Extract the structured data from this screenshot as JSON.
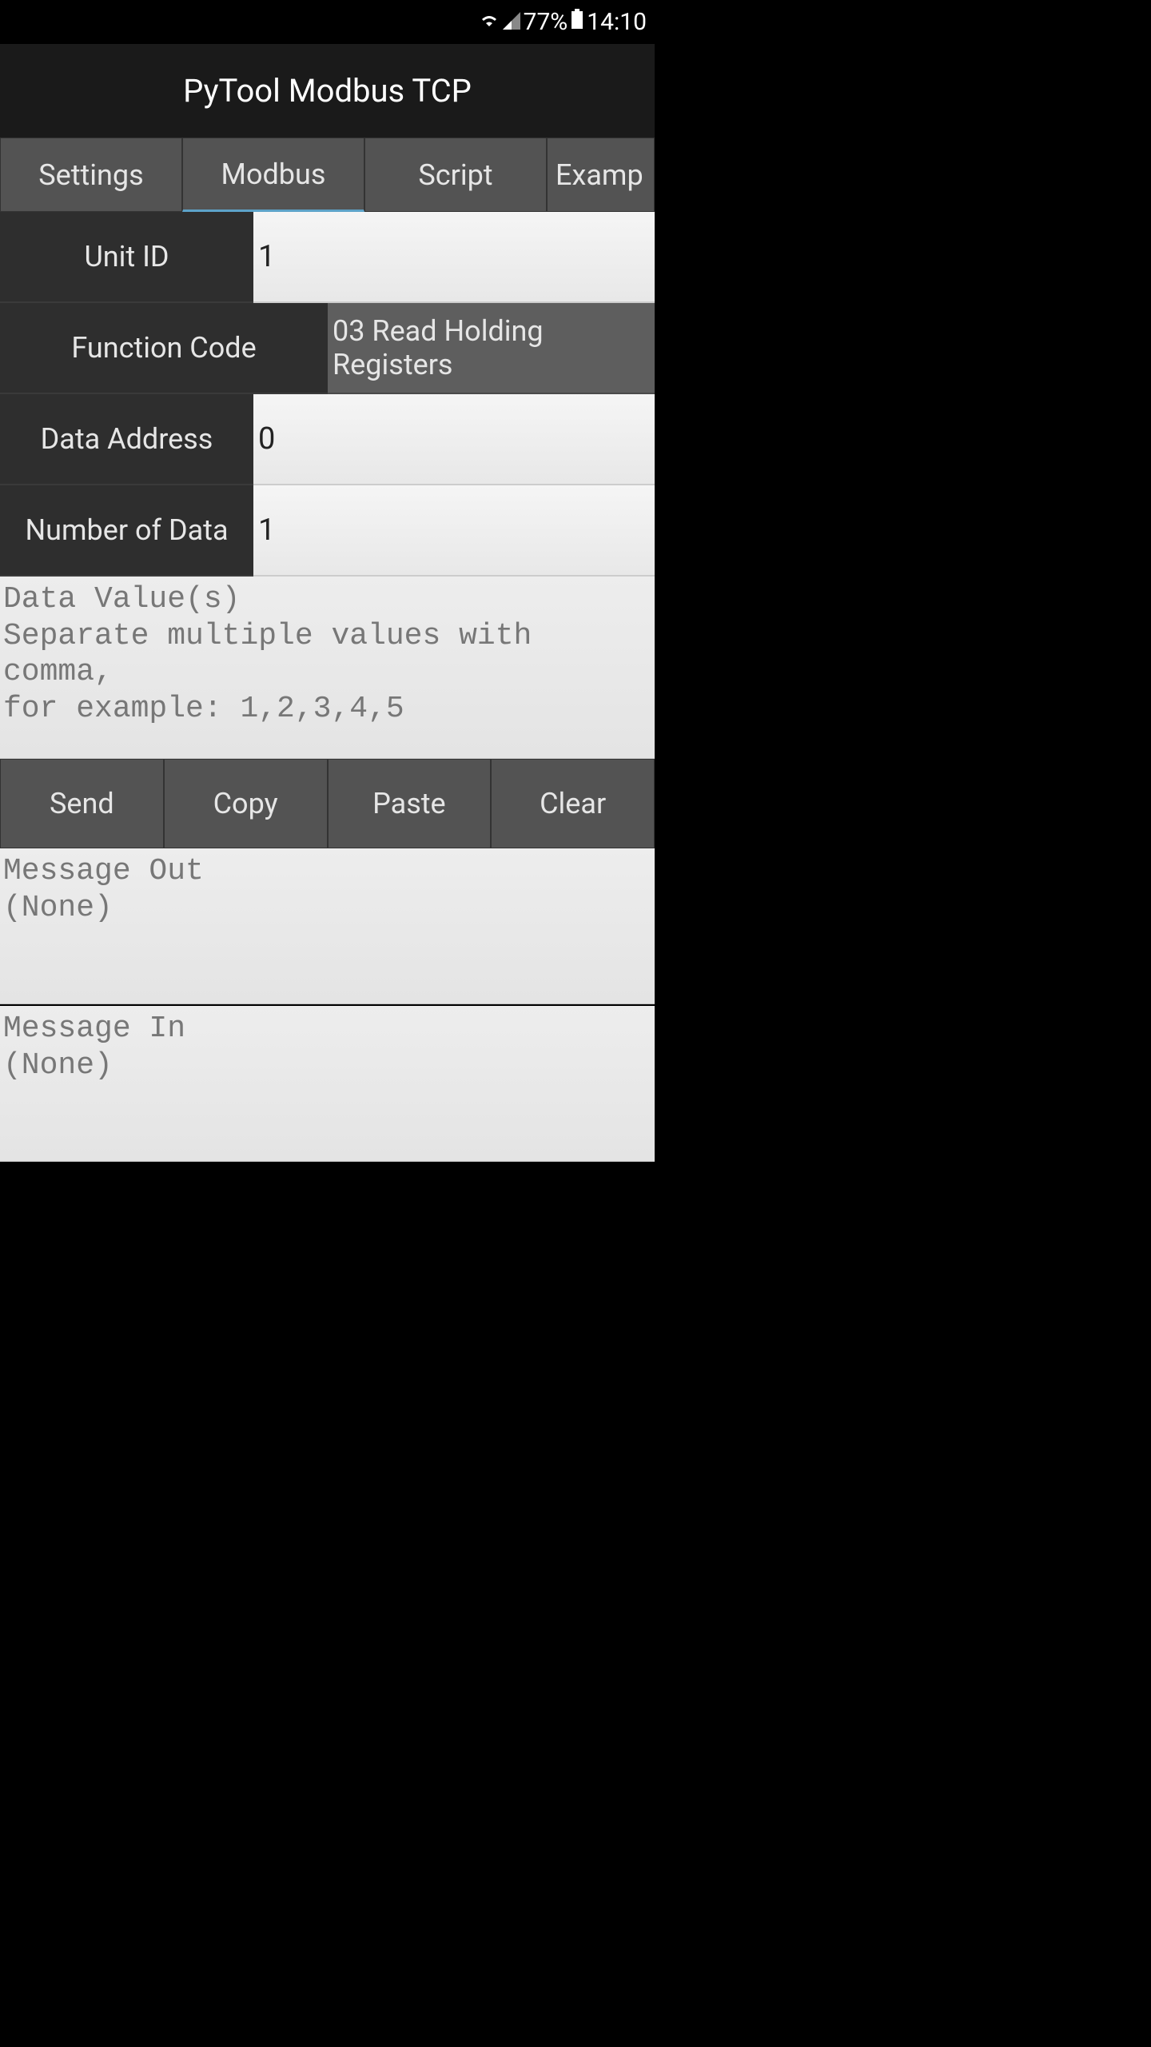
{
  "status_bar": {
    "battery_percent": "77%",
    "time": "14:10"
  },
  "app_title": "PyTool Modbus TCP",
  "tabs": {
    "settings": "Settings",
    "modbus": "Modbus",
    "script": "Script",
    "example": "Examp"
  },
  "form": {
    "unit_id": {
      "label": "Unit ID",
      "value": "1"
    },
    "function_code": {
      "label": "Function Code",
      "value": "03 Read Holding Registers"
    },
    "data_address": {
      "label": "Data Address",
      "value": "0"
    },
    "number_of_data": {
      "label": "Number of Data",
      "value": "1"
    }
  },
  "data_value": {
    "placeholder": "Data Value(s)\nSeparate multiple values with comma,\nfor example: 1,2,3,4,5"
  },
  "buttons": {
    "send": "Send",
    "copy": "Copy",
    "paste": "Paste",
    "clear": "Clear"
  },
  "message_out": {
    "label": "Message Out",
    "value": "(None)"
  },
  "message_in": {
    "label": "Message In",
    "value": "(None)"
  }
}
